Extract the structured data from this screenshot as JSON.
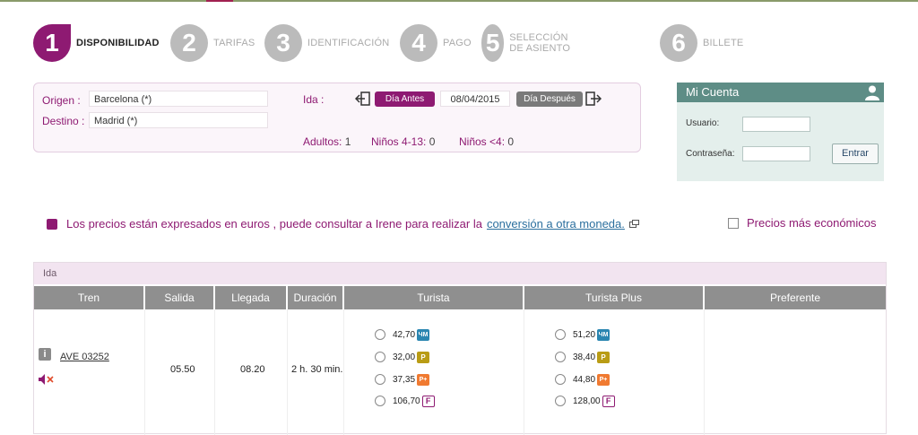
{
  "steps": [
    {
      "num": "1",
      "label": "DISPONIBILIDAD",
      "active": true
    },
    {
      "num": "2",
      "label": "TARIFAS",
      "active": false
    },
    {
      "num": "3",
      "label": "IDENTIFICACIÓN",
      "active": false
    },
    {
      "num": "4",
      "label": "PAGO",
      "active": false
    },
    {
      "num": "5",
      "label": "SELECCIÓN DE ASIENTO",
      "active": false
    },
    {
      "num": "6",
      "label": "BILLETE",
      "active": false
    }
  ],
  "search": {
    "origin_label": "Origen :",
    "origin_value": "Barcelona (*)",
    "destination_label": "Destino :",
    "destination_value": "Madrid (*)",
    "ida_label": "Ida :",
    "prev_day": "Día Antes",
    "date": "08/04/2015",
    "next_day": "Día Después",
    "adults_label": "Adultos:",
    "adults": "1",
    "kids_label": "Niños 4-13:",
    "kids": "0",
    "infants_label": "Niños <4:",
    "infants": "0"
  },
  "account": {
    "title": "Mi Cuenta",
    "user_label": "Usuario:",
    "password_label": "Contraseña:",
    "submit": "Entrar"
  },
  "info": {
    "text": "Los precios están expresados en euros , puede consultar a Irene para realizar la",
    "link": "conversión a otra moneda.",
    "cheapest": "Precios más económicos"
  },
  "results": {
    "section": "Ida",
    "headers": [
      "Tren",
      "Salida",
      "Llegada",
      "Duración",
      "Turista",
      "Turista Plus",
      "Preferente"
    ],
    "train": "AVE 03252",
    "departure": "05.50",
    "arrival": "08.20",
    "duration": "2 h. 30 min.",
    "turista": [
      "42,70",
      "32,00",
      "37,35",
      "106,70"
    ],
    "turista_plus": [
      "51,20",
      "38,40",
      "44,80",
      "128,00"
    ],
    "fare_badges": [
      "ЧМ",
      "P",
      "P+",
      "F"
    ]
  },
  "colors": {
    "brand": "#8e1a72",
    "account_header": "#5e8d86",
    "table_header": "#8f8f8f"
  }
}
